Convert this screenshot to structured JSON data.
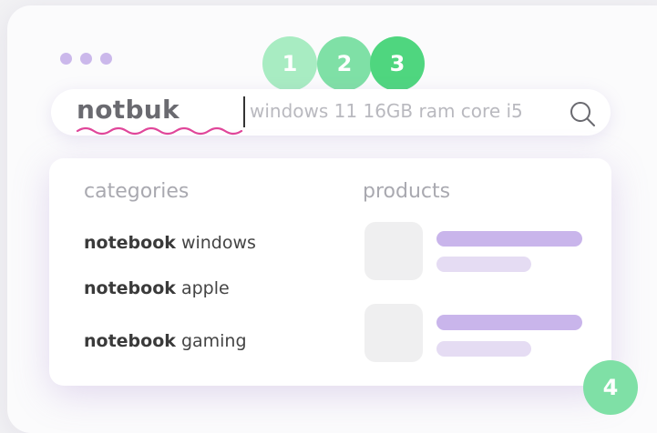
{
  "window": {
    "dots": [
      "dot",
      "dot",
      "dot"
    ]
  },
  "steps": [
    "1",
    "2",
    "3",
    "4"
  ],
  "search": {
    "query": "notbuk",
    "hint": "windows 11 16GB ram core i5",
    "icon": "search-icon"
  },
  "results": {
    "categories_heading": "categories",
    "products_heading": "products",
    "categories": [
      {
        "bold": "notebook",
        "rest": " windows"
      },
      {
        "bold": "notebook",
        "rest": " apple"
      },
      {
        "bold": "notebook",
        "rest": " gaming"
      }
    ]
  },
  "colors": {
    "accent_purple": "#c9b5eb",
    "accent_green": "#4fd67f",
    "spellcheck_underline": "#e0469a"
  }
}
